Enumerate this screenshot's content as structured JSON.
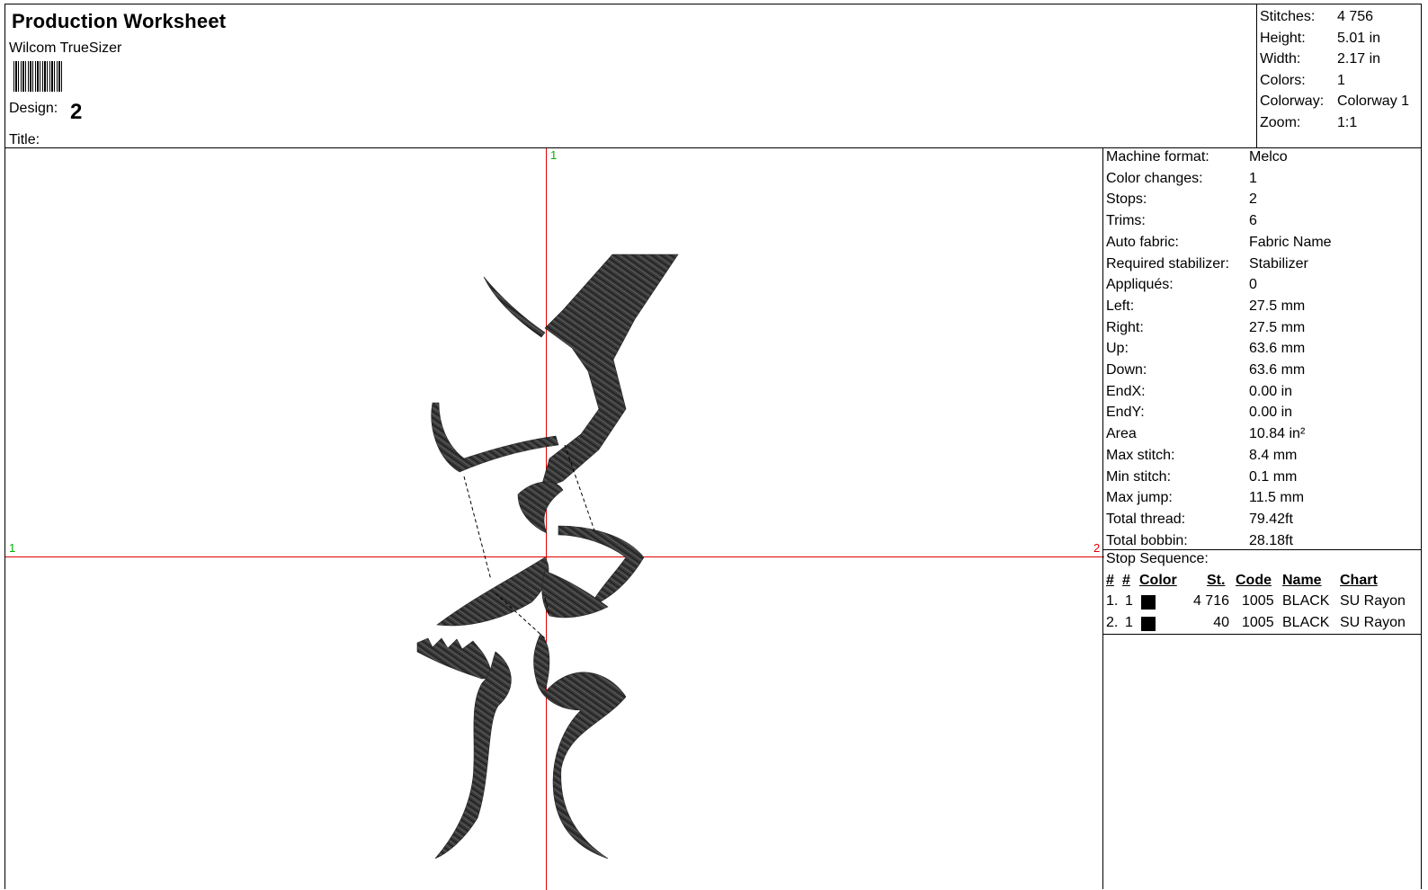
{
  "header": {
    "title": "Production Worksheet",
    "software": "Wilcom TrueSizer",
    "design_label": "Design:",
    "design_value": "2",
    "title_label": "Title:"
  },
  "summary": [
    {
      "label": "Stitches:",
      "value": "4 756"
    },
    {
      "label": "Height:",
      "value": "5.01 in"
    },
    {
      "label": "Width:",
      "value": "2.17 in"
    },
    {
      "label": "Colors:",
      "value": "1"
    },
    {
      "label": "Colorway:",
      "value": "Colorway 1"
    },
    {
      "label": "Zoom:",
      "value": "1:1"
    }
  ],
  "specs": [
    {
      "label": "Machine format:",
      "value": "Melco"
    },
    {
      "label": "Color changes:",
      "value": "1"
    },
    {
      "label": "Stops:",
      "value": "2"
    },
    {
      "label": "Trims:",
      "value": "6"
    },
    {
      "label": "Auto fabric:",
      "value": "Fabric Name"
    },
    {
      "label": "Required stabilizer:",
      "value": "Stabilizer"
    },
    {
      "label": "Appliqués:",
      "value": "0"
    },
    {
      "label": "Left:",
      "value": "27.5 mm"
    },
    {
      "label": "Right:",
      "value": "27.5 mm"
    },
    {
      "label": "Up:",
      "value": "63.6 mm"
    },
    {
      "label": "Down:",
      "value": "63.6 mm"
    },
    {
      "label": "EndX:",
      "value": "0.00 in"
    },
    {
      "label": "EndY:",
      "value": "0.00 in"
    },
    {
      "label": "Area",
      "value": " 10.84 in²"
    },
    {
      "label": "Max stitch:",
      "value": "8.4 mm"
    },
    {
      "label": "Min stitch:",
      "value": "0.1 mm"
    },
    {
      "label": "Max jump:",
      "value": "11.5 mm"
    },
    {
      "label": "Total thread:",
      "value": "79.42ft"
    },
    {
      "label": "Total bobbin:",
      "value": "28.18ft"
    }
  ],
  "stop_sequence": {
    "heading": "Stop Sequence:",
    "columns": [
      "#",
      "#",
      "Color",
      "St.",
      "Code",
      "Name",
      "Chart"
    ],
    "rows": [
      {
        "n": "1.",
        "k": "1",
        "color": "#000000",
        "st": "4 716",
        "code": "1005",
        "name": "BLACK",
        "chart": "SU Rayon"
      },
      {
        "n": "2.",
        "k": "1",
        "color": "#000000",
        "st": "40",
        "code": "1005",
        "name": "BLACK",
        "chart": "SU Rayon"
      }
    ]
  },
  "canvas": {
    "axis_color": "#e00000",
    "top_marker": "1",
    "left_marker": "1",
    "right_marker": "2",
    "top_marker_color": "#00b000",
    "left_marker_color": "#00b000",
    "right_marker_color": "#e00000"
  }
}
